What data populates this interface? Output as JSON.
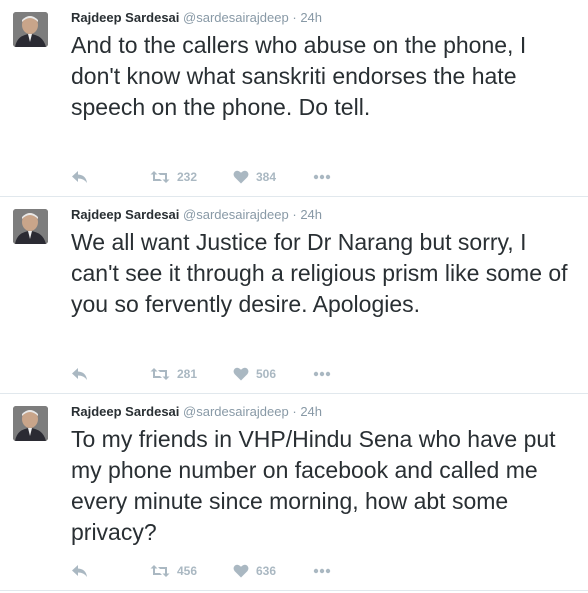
{
  "tweets": [
    {
      "name": "Rajdeep Sardesai",
      "handle": "@sardesairajdeep",
      "separator": "·",
      "time": "24h",
      "text": "And to the callers who abuse on the phone, I don't know what sanskriti endorses the hate speech on the phone. Do tell.",
      "retweets": "232",
      "likes": "384"
    },
    {
      "name": "Rajdeep Sardesai",
      "handle": "@sardesairajdeep",
      "separator": "·",
      "time": "24h",
      "text": "We all want Justice for Dr Narang but sorry, I can't see it through a religious prism like some of you so fervently desire. Apologies.",
      "retweets": "281",
      "likes": "506"
    },
    {
      "name": "Rajdeep Sardesai",
      "handle": "@sardesairajdeep",
      "separator": "·",
      "time": "24h",
      "text": "To my friends in VHP/Hindu Sena who have put my phone number on facebook and called me every minute since morning, how abt some privacy?",
      "retweets": "456",
      "likes": "636"
    }
  ],
  "icons": {
    "reply": "reply-icon",
    "retweet": "retweet-icon",
    "like": "heart-icon",
    "more": "more-dots-icon"
  },
  "colors": {
    "text": "#292f33",
    "secondary": "#8899a6",
    "action": "#aab8c2",
    "divider": "#e1e8ed"
  }
}
